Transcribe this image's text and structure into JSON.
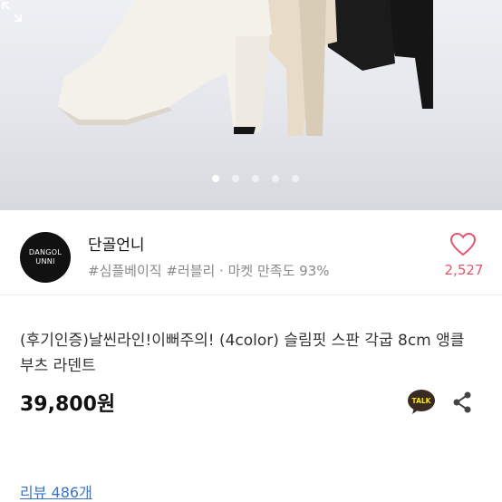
{
  "carousel": {
    "slide_count": 5,
    "active_index": 0,
    "expand_icon": "expand-icon"
  },
  "store": {
    "logo_line1": "DANGOL",
    "logo_line2": "UNNI",
    "name": "단골언니",
    "tags": "#심플베이직 #러블리 · 마켓 만족도 93%",
    "like_count": "2,527",
    "like_icon": "heart-icon",
    "accent_color": "#e2576f"
  },
  "product": {
    "title": "(후기인증)날씬라인!이뻐주의! (4color) 슬림핏 스판 각굽 8cm 앵클부츠 라덴트",
    "price": "39,800원",
    "talk_label": "TALK",
    "share_icon": "share-icon"
  },
  "reviews": {
    "link_label": "리뷰 486개"
  }
}
